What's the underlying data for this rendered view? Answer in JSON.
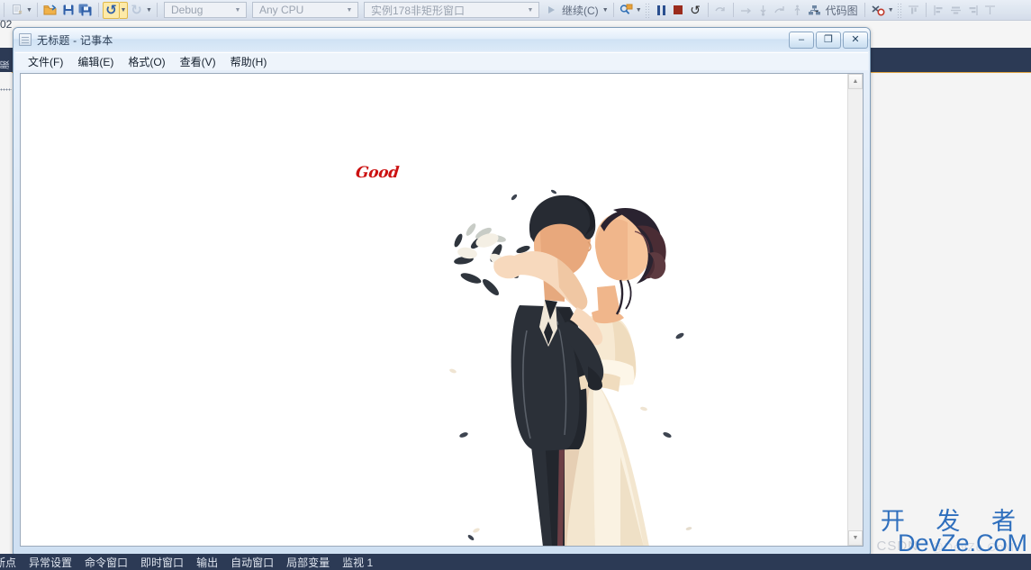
{
  "vs_toolbar": {
    "combo_config": {
      "value": "Debug",
      "placeholder": "Debug"
    },
    "combo_platform": {
      "value": "Any CPU",
      "placeholder": "Any CPU"
    },
    "combo_startup": {
      "value": "实例178非矩形窗口",
      "placeholder": "实例178非矩形窗口"
    },
    "continue_label": "继续(C)",
    "codemap_label": "代码图",
    "icons": [
      "new-item-icon",
      "dropdown-caret",
      "open-folder-icon",
      "save-icon",
      "save-all-icon",
      "undo-icon",
      "undo-caret",
      "redo-icon",
      "redo-caret",
      "start-icon",
      "find-icon",
      "pause-icon",
      "stop-icon",
      "restart-icon",
      "step-over-icon",
      "step-into-icon",
      "step-out-icon",
      "codemap-icon",
      "no-break-icon",
      "align-icon"
    ]
  },
  "left_edge": {
    "partial_number": "02",
    "tab_label": "服"
  },
  "notepad": {
    "title": "无标题 - 记事本",
    "title_icon": "notepad-icon",
    "window_buttons": {
      "minimize": "–",
      "restore": "❐",
      "close": "✕"
    },
    "menus": [
      {
        "label": "文件(F)"
      },
      {
        "label": "编辑(E)"
      },
      {
        "label": "格式(O)"
      },
      {
        "label": "查看(V)"
      },
      {
        "label": "帮助(H)"
      }
    ],
    "canvas": {
      "good_text": "Good",
      "good_color": "#cc1111",
      "illustration_name": "wedding-couple-illustration"
    },
    "scrollbar": {
      "up": "▲",
      "down": "▼"
    }
  },
  "bottom_tabs": [
    {
      "label": "断点"
    },
    {
      "label": "异常设置"
    },
    {
      "label": "命令窗口"
    },
    {
      "label": "即时窗口"
    },
    {
      "label": "输出"
    },
    {
      "label": "自动窗口"
    },
    {
      "label": "局部变量"
    },
    {
      "label": "监视 1"
    }
  ],
  "watermark": {
    "cn": "开 发 者",
    "en": "DevZe.CoM",
    "csdn": "CSDN",
    "faint": "@DevZe.CoM",
    "color": "#2f6fbd"
  },
  "colors": {
    "navy": "#2c3a55",
    "accent_orange": "#e0a441",
    "toolbar_top": "#e9eef6"
  }
}
